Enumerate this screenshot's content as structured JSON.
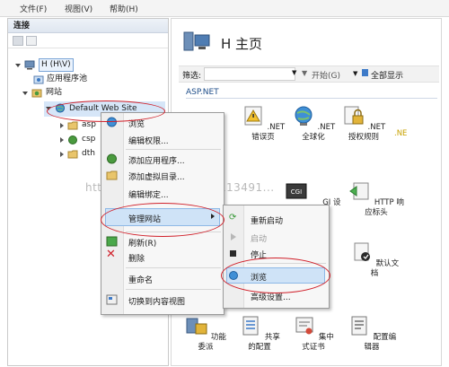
{
  "menubar": {
    "items": [
      "文件(F)",
      "视图(V)",
      "帮助(H)"
    ]
  },
  "connections": {
    "title": "连接",
    "tree": {
      "server": "H (H\\V)",
      "app_pools": "应用程序池",
      "sites": "网站",
      "default_site": "Default Web Site",
      "children": [
        "asp",
        "csp",
        "dth"
      ]
    }
  },
  "home": {
    "title": "H 主页",
    "filter_label": "筛选:",
    "start_label": "开始(G)",
    "show_all_label": "全部显示",
    "section": "ASP.NET",
    "features_row1": [
      ".NET 错误页",
      ".NET 全球化",
      ".NET 授权规则"
    ],
    "features_row1_partial": [
      ".NE"
    ],
    "features_row2_partial": [
      "GI 设",
      "HTTP 响应标头"
    ],
    "default_doc": "默认文档",
    "features_bottom": [
      "功能委派",
      "共享的配置",
      "集中式证书",
      "配置编辑器"
    ]
  },
  "context_menu": {
    "items": [
      "浏览",
      "编辑权限...",
      "添加应用程序...",
      "添加虚拟目录...",
      "编辑绑定...",
      "管理网站",
      "刷新(R)",
      "删除",
      "重命名",
      "切换到内容视图"
    ]
  },
  "submenu": {
    "items": [
      "重新启动",
      "启动",
      "停止",
      "浏览",
      "高级设置..."
    ]
  },
  "watermark": "http://blog.csdn.net/u0113491..."
}
